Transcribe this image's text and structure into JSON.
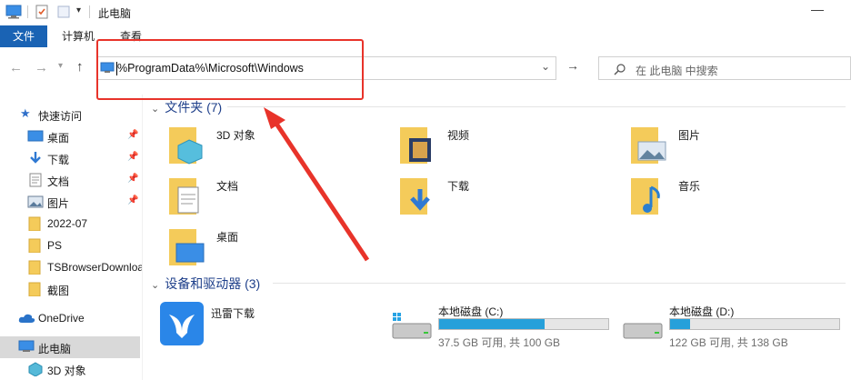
{
  "window": {
    "title": "此电脑"
  },
  "ribbon": {
    "tabs": [
      {
        "label": "文件"
      },
      {
        "label": "计算机"
      },
      {
        "label": "查看"
      }
    ]
  },
  "address": {
    "path": "%ProgramData%\\Microsoft\\Windows"
  },
  "search": {
    "placeholder": "在 此电脑 中搜索"
  },
  "sidebar": {
    "items": [
      {
        "label": "快速访问",
        "icon": "star-icon"
      },
      {
        "label": "桌面",
        "icon": "desktop-icon",
        "pinned": true
      },
      {
        "label": "下载",
        "icon": "download-icon",
        "pinned": true
      },
      {
        "label": "文档",
        "icon": "document-icon",
        "pinned": true
      },
      {
        "label": "图片",
        "icon": "picture-icon",
        "pinned": true
      },
      {
        "label": "2022-07",
        "icon": "folder-icon"
      },
      {
        "label": "PS",
        "icon": "folder-icon"
      },
      {
        "label": "TSBrowserDownloads",
        "icon": "folder-icon"
      },
      {
        "label": "截图",
        "icon": "folder-icon"
      },
      {
        "label": "OneDrive",
        "icon": "cloud-icon"
      },
      {
        "label": "此电脑",
        "icon": "computer-icon",
        "selected": true
      },
      {
        "label": "3D 对象",
        "icon": "3d-objects-icon"
      }
    ]
  },
  "main": {
    "folders_header": "文件夹 (7)",
    "folders": [
      {
        "label": "3D 对象",
        "icon": "3d-objects-icon"
      },
      {
        "label": "视频",
        "icon": "video-icon"
      },
      {
        "label": "图片",
        "icon": "picture-icon"
      },
      {
        "label": "文档",
        "icon": "document-icon"
      },
      {
        "label": "下载",
        "icon": "download-icon"
      },
      {
        "label": "音乐",
        "icon": "music-icon"
      },
      {
        "label": "桌面",
        "icon": "desktop-icon"
      }
    ],
    "devices_header": "设备和驱动器 (3)",
    "devices": [
      {
        "label": "迅雷下载",
        "icon": "xunlei-icon"
      },
      {
        "label": "本地磁盘 (C:)",
        "used_fraction": 0.625,
        "status": "37.5 GB 可用, 共 100 GB",
        "icon": "disk-icon"
      },
      {
        "label": "本地磁盘 (D:)",
        "used_fraction": 0.116,
        "status": "122 GB 可用, 共 138 GB",
        "icon": "disk-icon"
      }
    ]
  },
  "colors": {
    "accent": "#1a63b4",
    "annotation": "#e8332a",
    "drive_bar": "#26a0da",
    "folder": "#f4cb5a"
  }
}
